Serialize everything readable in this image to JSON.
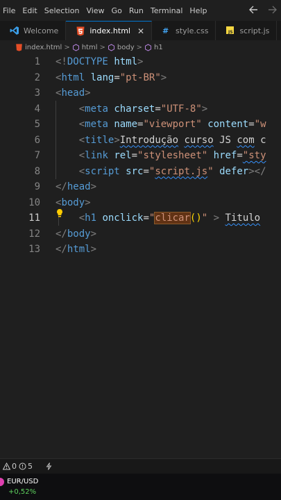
{
  "menubar": {
    "items": [
      "File",
      "Edit",
      "Selection",
      "View",
      "Go",
      "Run",
      "Terminal",
      "Help"
    ]
  },
  "tabs": [
    {
      "label": "Welcome",
      "icon": "vscode-icon",
      "active": false
    },
    {
      "label": "index.html",
      "icon": "html5-icon",
      "active": true,
      "close": "✕"
    },
    {
      "label": "style.css",
      "icon": "css-icon",
      "active": false
    },
    {
      "label": "script.js",
      "icon": "js-icon",
      "active": false
    }
  ],
  "breadcrumb": {
    "file": "index.html",
    "items": [
      "html",
      "body",
      "h1"
    ],
    "separator": ">"
  },
  "editor": {
    "current_line": 11,
    "line_numbers": [
      "1",
      "2",
      "3",
      "4",
      "5",
      "6",
      "7",
      "8",
      "9",
      "10",
      "11",
      "12",
      "13"
    ],
    "lines": [
      [
        [
          "t",
          "<!"
        ],
        [
          "g",
          "DOCTYPE"
        ],
        [
          "w",
          " "
        ],
        [
          "a",
          "html"
        ],
        [
          "t",
          ">"
        ]
      ],
      [
        [
          "t",
          "<"
        ],
        [
          "g",
          "html"
        ],
        [
          "w",
          " "
        ],
        [
          "a",
          "lang"
        ],
        [
          "w",
          "="
        ],
        [
          "s",
          "\"pt-BR\""
        ],
        [
          "t",
          ">"
        ]
      ],
      [
        [
          "t",
          "<"
        ],
        [
          "g",
          "head"
        ],
        [
          "t",
          ">"
        ]
      ],
      [
        [
          "w",
          "    "
        ],
        [
          "t",
          "<"
        ],
        [
          "g",
          "meta"
        ],
        [
          "w",
          " "
        ],
        [
          "a",
          "charset"
        ],
        [
          "w",
          "="
        ],
        [
          "s",
          "\"UTF-8\""
        ],
        [
          "t",
          ">"
        ]
      ],
      [
        [
          "w",
          "    "
        ],
        [
          "t",
          "<"
        ],
        [
          "g",
          "meta"
        ],
        [
          "w",
          " "
        ],
        [
          "a",
          "name"
        ],
        [
          "w",
          "="
        ],
        [
          "s",
          "\"viewport\""
        ],
        [
          "w",
          " "
        ],
        [
          "a",
          "content"
        ],
        [
          "w",
          "="
        ],
        [
          "s",
          "\"w"
        ]
      ],
      [
        [
          "w",
          "    "
        ],
        [
          "t",
          "<"
        ],
        [
          "g",
          "title"
        ],
        [
          "t",
          ">"
        ],
        [
          "w|sq",
          "Introdução"
        ],
        [
          "w",
          " "
        ],
        [
          "w|sq",
          "curso"
        ],
        [
          "w",
          " JS "
        ],
        [
          "w|sq",
          "com"
        ],
        [
          "w",
          " c"
        ]
      ],
      [
        [
          "w",
          "    "
        ],
        [
          "t",
          "<"
        ],
        [
          "g",
          "link"
        ],
        [
          "w",
          " "
        ],
        [
          "a",
          "rel"
        ],
        [
          "w",
          "="
        ],
        [
          "s",
          "\"stylesheet\""
        ],
        [
          "w",
          " "
        ],
        [
          "a",
          "href"
        ],
        [
          "w",
          "="
        ],
        [
          "s|sq",
          "\"sty"
        ]
      ],
      [
        [
          "w",
          "    "
        ],
        [
          "t",
          "<"
        ],
        [
          "g",
          "script"
        ],
        [
          "w",
          " "
        ],
        [
          "a",
          "src"
        ],
        [
          "w",
          "="
        ],
        [
          "s",
          "\""
        ],
        [
          "s|sq",
          "script.js"
        ],
        [
          "s",
          "\""
        ],
        [
          "w",
          " "
        ],
        [
          "a",
          "defer"
        ],
        [
          "t",
          "></"
        ]
      ],
      [
        [
          "t",
          "</"
        ],
        [
          "g",
          "head"
        ],
        [
          "t",
          ">"
        ]
      ],
      [
        [
          "t",
          "<"
        ],
        [
          "g",
          "body"
        ],
        [
          "t",
          ">"
        ]
      ],
      [
        [
          "w",
          "    "
        ],
        [
          "t",
          "<"
        ],
        [
          "g",
          "h1"
        ],
        [
          "w",
          " "
        ],
        [
          "a",
          "onclick"
        ],
        [
          "w",
          "="
        ],
        [
          "s",
          "\""
        ],
        [
          "s|hl",
          "clicar"
        ],
        [
          "y",
          "()"
        ],
        [
          "s",
          "\""
        ],
        [
          "w",
          " "
        ],
        [
          "t",
          ">"
        ],
        [
          "w",
          " "
        ],
        [
          "w|sq",
          "Titulo"
        ]
      ],
      [
        [
          "t",
          "</"
        ],
        [
          "g",
          "body"
        ],
        [
          "t",
          ">"
        ]
      ],
      [
        [
          "t",
          "</"
        ],
        [
          "g",
          "html"
        ],
        [
          "t",
          ">"
        ]
      ]
    ]
  },
  "status": {
    "errors": "0",
    "warnings": "5"
  },
  "ticker": {
    "pair": "EUR/USD",
    "change": "+0,52%"
  }
}
